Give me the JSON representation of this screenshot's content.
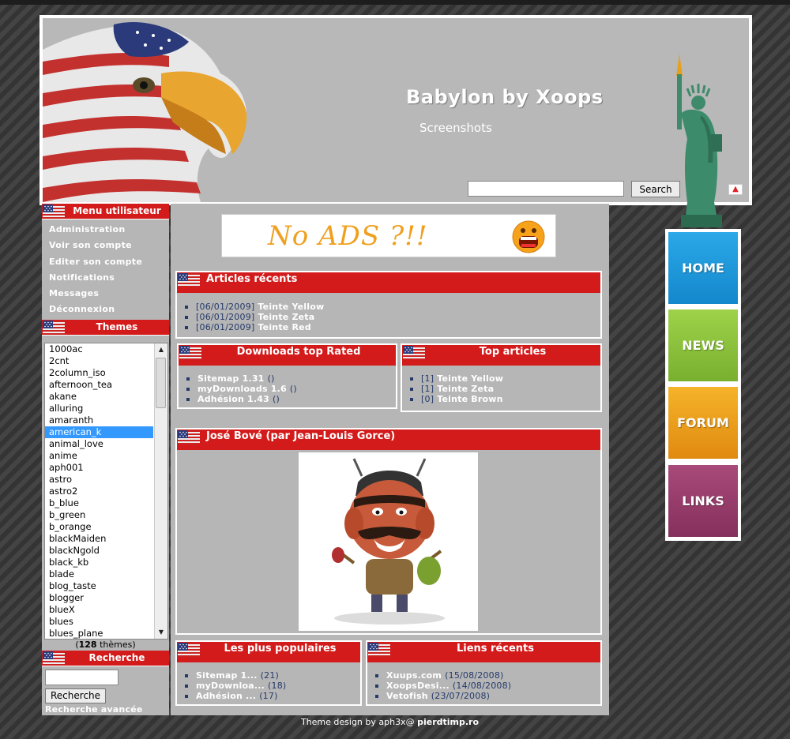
{
  "header": {
    "site_name": "Babylon by Xoops",
    "slogan": "Screenshots",
    "search_placeholder": "",
    "search_button": "Search"
  },
  "user_menu": {
    "title": "Menu utilisateur",
    "items": [
      "Administration",
      "Voir son compte",
      "Editer son compte",
      "Notifications",
      "Messages",
      "Déconnexion"
    ]
  },
  "themes": {
    "title": "Themes",
    "list": [
      "1000ac",
      "2cnt",
      "2column_iso",
      "afternoon_tea",
      "akane",
      "alluring",
      "amaranth",
      "american_k",
      "animal_love",
      "anime",
      "aph001",
      "astro",
      "astro2",
      "b_blue",
      "b_green",
      "b_orange",
      "blackMaiden",
      "blackNgold",
      "black_kb",
      "blade",
      "blog_taste",
      "blogger",
      "blueX",
      "blues",
      "blues_plane"
    ],
    "selected": "american_k",
    "count": "128",
    "count_suffix": " thèmes"
  },
  "search_block": {
    "title": "Recherche",
    "button": "Recherche",
    "advanced": "Recherche avancée"
  },
  "ad": {
    "text": "No ADS ?!!"
  },
  "recent_articles": {
    "title": "Articles récents",
    "items": [
      {
        "date": "[06/01/2009]",
        "title": "Teinte Yellow"
      },
      {
        "date": "[06/01/2009]",
        "title": "Teinte Zeta"
      },
      {
        "date": "[06/01/2009]",
        "title": "Teinte Red"
      }
    ]
  },
  "downloads_top": {
    "title": "Downloads top Rated",
    "items": [
      {
        "name": "Sitemap 1.31",
        "extra": "()"
      },
      {
        "name": "myDownloads 1.6",
        "extra": "()"
      },
      {
        "name": "Adhésion 1.43",
        "extra": "()"
      }
    ]
  },
  "top_articles": {
    "title": "Top articles",
    "items": [
      {
        "count": "[1]",
        "title": "Teinte Yellow"
      },
      {
        "count": "[1]",
        "title": "Teinte Zeta"
      },
      {
        "count": "[0]",
        "title": "Teinte Brown"
      }
    ]
  },
  "featured": {
    "title": "José Bové (par Jean-Louis Gorce)"
  },
  "popular": {
    "title": "Les plus populaires",
    "items": [
      {
        "name": "Sitemap 1...",
        "count": "(21)"
      },
      {
        "name": "myDownloa...",
        "count": "(18)"
      },
      {
        "name": "Adhésion ...",
        "count": "(17)"
      }
    ]
  },
  "recent_links": {
    "title": "Liens récents",
    "items": [
      {
        "name": "Xuups.com",
        "date": "(15/08/2008)"
      },
      {
        "name": "XoopsDesi...",
        "date": "(14/08/2008)"
      },
      {
        "name": "Vetofish",
        "date": "(23/07/2008)"
      }
    ]
  },
  "nav": {
    "items": [
      {
        "label": "HOME",
        "color": "#1a9be0"
      },
      {
        "label": "NEWS",
        "color": "#8cc63f"
      },
      {
        "label": "FORUM",
        "color": "#f0a020"
      },
      {
        "label": "LINKS",
        "color": "#9a3c6a"
      }
    ]
  },
  "footer": {
    "prefix": "Theme design by aph3x@ ",
    "site": "pierdtimp.ro"
  },
  "colors": {
    "block_title": "#d31b1b",
    "panel": "#b6b6b6",
    "link_date": "#243a6a",
    "selected": "#3399ff"
  }
}
